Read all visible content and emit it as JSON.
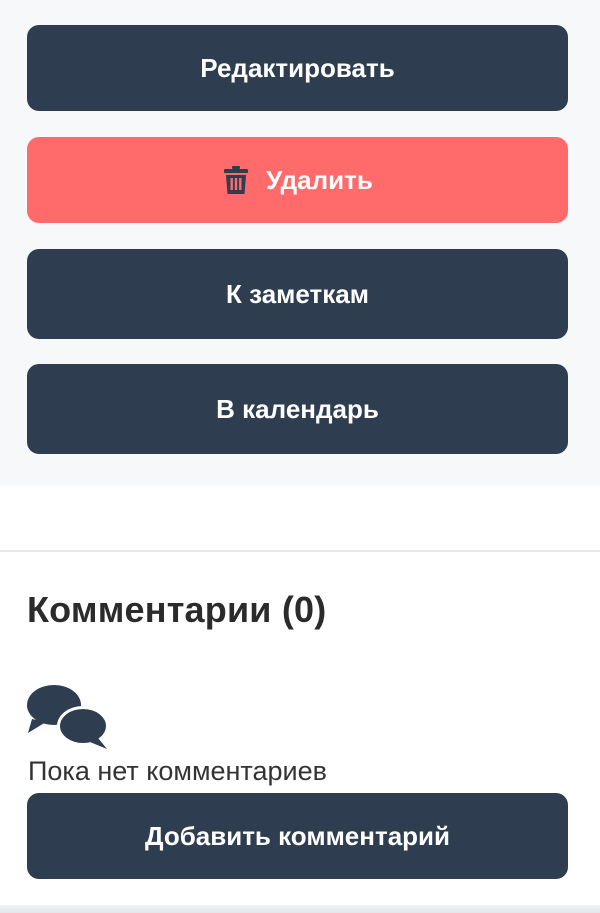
{
  "actions": {
    "edit_label": "Редактировать",
    "delete_label": "Удалить",
    "delete_icon": "trash-icon",
    "notes_label": "К заметкам",
    "calendar_label": "В календарь"
  },
  "comments": {
    "title": "Комментарии (0)",
    "empty_icon": "comments-icon",
    "empty_text": "Пока нет комментариев",
    "add_label": "Добавить комментарий"
  },
  "colors": {
    "primary": "#2e3d50",
    "danger": "#ff6b6b",
    "panel_bg": "#f7f8fa",
    "text": "#2b2b2b"
  }
}
